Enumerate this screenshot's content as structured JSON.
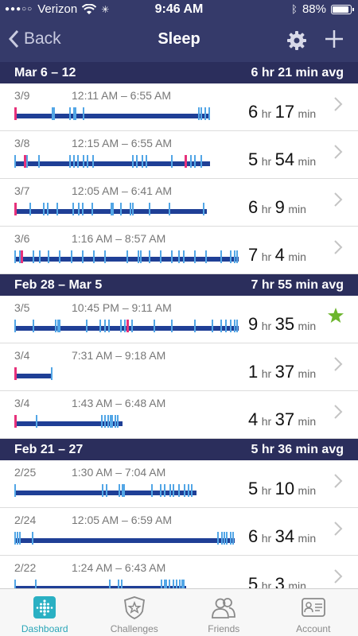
{
  "status_bar": {
    "carrier": "Verizon",
    "time": "9:46 AM",
    "battery": "88%"
  },
  "nav": {
    "back_label": "Back",
    "title": "Sleep"
  },
  "weeks": [
    {
      "label": "Mar 6 – 12",
      "avg": "6 hr 21 min avg",
      "days": [
        {
          "date": "3/9",
          "range": "12:11 AM – 6:55 AM",
          "hours": "6",
          "mins": "17",
          "starred": false,
          "bar_fraction": 0.56,
          "wake_at": [
            0.0
          ],
          "restless_at": [
            0.19,
            0.2,
            0.28,
            0.3,
            0.31,
            0.35,
            0.94,
            0.95,
            0.97,
            0.99
          ]
        },
        {
          "date": "3/8",
          "range": "12:15 AM – 6:55 AM",
          "hours": "5",
          "mins": "54",
          "starred": false,
          "bar_fraction": 0.56,
          "wake_at": [
            0.05,
            0.87
          ],
          "restless_at": [
            0.0,
            0.06,
            0.12,
            0.28,
            0.3,
            0.32,
            0.35,
            0.37,
            0.4,
            0.6,
            0.62,
            0.65,
            0.67,
            0.8,
            0.9,
            0.92,
            0.95
          ]
        },
        {
          "date": "3/7",
          "range": "12:05 AM – 6:41 AM",
          "hours": "6",
          "mins": "9",
          "starred": false,
          "bar_fraction": 0.55,
          "wake_at": [
            0.0
          ],
          "restless_at": [
            0.08,
            0.15,
            0.17,
            0.22,
            0.3,
            0.33,
            0.35,
            0.4,
            0.5,
            0.51,
            0.55,
            0.6,
            0.61,
            0.7,
            0.8,
            0.98
          ]
        },
        {
          "date": "3/6",
          "range": "1:16 AM – 8:57 AM",
          "hours": "7",
          "mins": "4",
          "starred": false,
          "bar_fraction": 0.64,
          "wake_at": [
            0.03
          ],
          "restless_at": [
            0.0,
            0.02,
            0.08,
            0.11,
            0.15,
            0.2,
            0.25,
            0.3,
            0.35,
            0.4,
            0.5,
            0.55,
            0.56,
            0.6,
            0.65,
            0.7,
            0.73,
            0.75,
            0.8,
            0.85,
            0.92,
            0.96,
            0.98,
            0.99
          ]
        }
      ]
    },
    {
      "label": "Feb 28 – Mar 5",
      "avg": "7 hr 55 min avg",
      "days": [
        {
          "date": "3/5",
          "range": "10:45 PM – 9:11 AM",
          "hours": "9",
          "mins": "35",
          "starred": true,
          "bar_fraction": 0.64,
          "wake_at": [
            0.5
          ],
          "restless_at": [
            0.0,
            0.08,
            0.18,
            0.19,
            0.2,
            0.32,
            0.38,
            0.4,
            0.42,
            0.47,
            0.49,
            0.52,
            0.62,
            0.7,
            0.8,
            0.88,
            0.92,
            0.94,
            0.96,
            0.98,
            0.99
          ]
        },
        {
          "date": "3/4",
          "range": "7:31 AM – 9:18 AM",
          "hours": "1",
          "mins": "37",
          "starred": false,
          "bar_fraction": 0.11,
          "wake_at": [
            0.0
          ],
          "restless_at": [
            0.96
          ]
        },
        {
          "date": "3/4",
          "range": "1:43 AM – 6:48 AM",
          "hours": "4",
          "mins": "37",
          "starred": false,
          "bar_fraction": 0.31,
          "wake_at": [
            0.0
          ],
          "restless_at": [
            0.2,
            0.8,
            0.83,
            0.86,
            0.88,
            0.9,
            0.93,
            0.95
          ]
        }
      ]
    },
    {
      "label": "Feb 21 – 27",
      "avg": "5 hr 36 min avg",
      "days": [
        {
          "date": "2/25",
          "range": "1:30 AM – 7:04 AM",
          "hours": "5",
          "mins": "10",
          "starred": false,
          "bar_fraction": 0.52,
          "wake_at": [],
          "restless_at": [
            0.0,
            0.48,
            0.5,
            0.57,
            0.59,
            0.6,
            0.75,
            0.8,
            0.82,
            0.85,
            0.87,
            0.9,
            0.93,
            0.95,
            0.97
          ]
        },
        {
          "date": "2/24",
          "range": "12:05 AM – 6:59 AM",
          "hours": "6",
          "mins": "34",
          "starred": false,
          "bar_fraction": 0.63,
          "wake_at": [],
          "restless_at": [
            0.0,
            0.01,
            0.02,
            0.08,
            0.92,
            0.94,
            0.95,
            0.96,
            0.98,
            0.99
          ]
        },
        {
          "date": "2/22",
          "range": "1:24 AM – 6:43 AM",
          "hours": "5",
          "mins": "3",
          "starred": false,
          "bar_fraction": 0.49,
          "wake_at": [],
          "restless_at": [
            0.0,
            0.12,
            0.55,
            0.6,
            0.62,
            0.85,
            0.87,
            0.88,
            0.9,
            0.92,
            0.94,
            0.96,
            0.97,
            0.98
          ]
        }
      ]
    }
  ],
  "units": {
    "hr": "hr",
    "min": "min"
  },
  "colors": {
    "header": "#353a6a",
    "week_header": "#2b2e5c",
    "asleep": "#1f3f96",
    "restless": "#52a6e6",
    "awake": "#e6317b",
    "star": "#6cb52d",
    "active_tab": "#2aa6b8"
  },
  "tabs": [
    {
      "label": "Dashboard",
      "icon": "dashboard-icon",
      "active": true
    },
    {
      "label": "Challenges",
      "icon": "challenges-icon",
      "active": false
    },
    {
      "label": "Friends",
      "icon": "friends-icon",
      "active": false
    },
    {
      "label": "Account",
      "icon": "account-icon",
      "active": false
    }
  ]
}
